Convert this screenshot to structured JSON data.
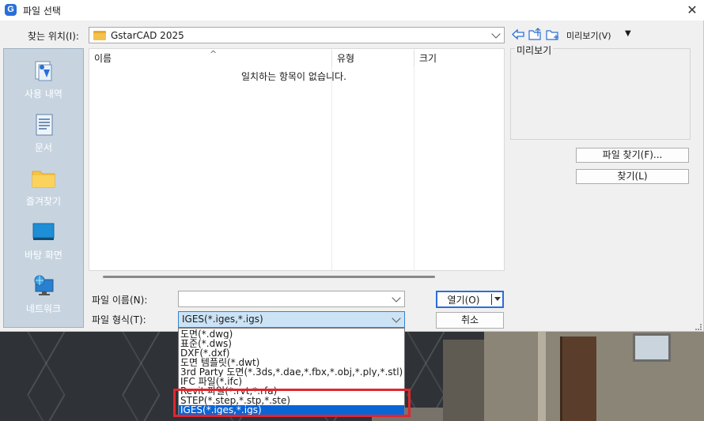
{
  "window": {
    "title": "파일 선택",
    "close_glyph": "✕",
    "app_icon_glyph": "G"
  },
  "lookin": {
    "label": "찾는 위치(I):",
    "value": "GstarCAD 2025"
  },
  "toolbar": {
    "views_label": "미리보기(V)",
    "views_arrow": "▼"
  },
  "places": [
    {
      "label": "사용 내역",
      "icon": "recent-icon"
    },
    {
      "label": "문서",
      "icon": "documents-icon"
    },
    {
      "label": "즐겨찾기",
      "icon": "favorites-folder-icon"
    },
    {
      "label": "바탕 화면",
      "icon": "desktop-icon"
    },
    {
      "label": "네트워크",
      "icon": "network-icon"
    }
  ],
  "filelist": {
    "columns": [
      "이름",
      "유형",
      "크기"
    ],
    "empty_message": "일치하는 항목이 없습니다."
  },
  "preview": {
    "label": "미리보기"
  },
  "buttons": {
    "find_file": "파일 찾기(F)...",
    "find": "찾기(L)",
    "open": "열기(O)",
    "cancel": "취소"
  },
  "filename": {
    "label": "파일 이름(N):",
    "value": ""
  },
  "filetype": {
    "label": "파일 형식(T):",
    "value": "IGES(*.iges,*.igs)",
    "options": [
      "도면(*.dwg)",
      "표준(*.dws)",
      "DXF(*.dxf)",
      "도면 템플릿(*.dwt)",
      "3rd Party 도면(*.3ds,*.dae,*.fbx,*.obj,*.ply,*.stl)",
      "IFC 파일(*.ifc)",
      "Revit 파일(*.rvt,*.rfa)",
      "STEP(*.step,*.stp,*.ste)",
      "IGES(*.iges,*.igs)"
    ],
    "selected_index": 8
  },
  "colors": {
    "accent": "#0a64d6",
    "highlight_border": "#e0262f",
    "places_bg": "#c7d4e0"
  }
}
